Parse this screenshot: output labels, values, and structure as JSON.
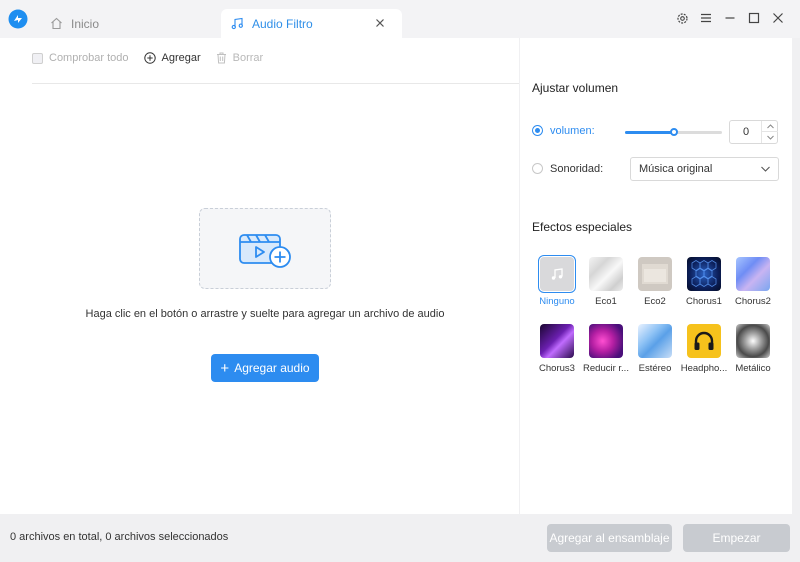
{
  "tabs": {
    "home_label": "Inicio",
    "active_label": "Audio Filtro"
  },
  "toolbar": {
    "check_all": "Comprobar todo",
    "add": "Agregar",
    "delete": "Borrar"
  },
  "main": {
    "drop_hint": "Haga clic en el botón o arrastre y suelte para agregar un archivo de audio",
    "add_audio_button": "Agregar audio"
  },
  "volume": {
    "section_title": "Ajustar volumen",
    "volume_label": "volumen:",
    "volume_value": "0",
    "volume_level_fraction": 0.5,
    "loudness_label": "Sonoridad:",
    "loudness_selected": "Música original"
  },
  "effects": {
    "section_title": "Efectos especiales",
    "items": [
      {
        "label": "Ninguno",
        "selected": true
      },
      {
        "label": "Eco1"
      },
      {
        "label": "Eco2"
      },
      {
        "label": "Chorus1"
      },
      {
        "label": "Chorus2"
      },
      {
        "label": "Chorus3"
      },
      {
        "label": "Reducir r..."
      },
      {
        "label": "Estéreo"
      },
      {
        "label": "Headpho..."
      },
      {
        "label": "Metálico"
      }
    ]
  },
  "footer": {
    "status": "0 archivos en total, 0 archivos seleccionados",
    "assemble_button": "Agregar al ensamblaje",
    "start_button": "Empezar"
  },
  "colors": {
    "accent": "#2d8cf0",
    "disabled_button": "#c8cbd0"
  }
}
